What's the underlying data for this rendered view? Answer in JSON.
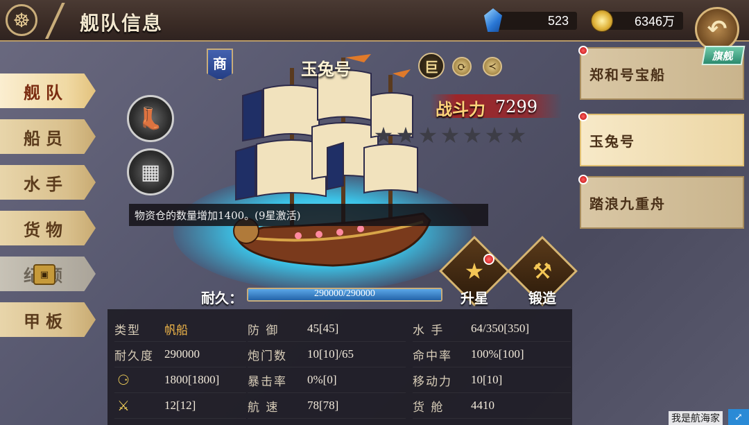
{
  "header": {
    "title": "舰队信息"
  },
  "resources": {
    "gems": "523",
    "gold": "6346万"
  },
  "tabs": [
    {
      "label": "舰队"
    },
    {
      "label": "船员"
    },
    {
      "label": "水手"
    },
    {
      "label": "货物"
    },
    {
      "label": "纪顾"
    },
    {
      "label": "甲板"
    }
  ],
  "ship": {
    "type_badge": "商",
    "name": "玉兔号",
    "size_badge": "巨",
    "power_label": "战斗力",
    "power_value": "7299",
    "stars_total": 7,
    "stars_filled": 0,
    "tooltip": "物资仓的数量增加1400。(9星激活)",
    "durability_label": "耐久：",
    "durability_text": "290000/290000",
    "durability_fraction": 1.0
  },
  "actions": {
    "upgrade_star": "升星",
    "forge": "锻造"
  },
  "stats": {
    "col1": [
      {
        "label": "类型",
        "value": "帆船"
      },
      {
        "label": "耐久度",
        "value": "290000"
      },
      {
        "icon": "cannon-icon",
        "value": "1800[1800]"
      },
      {
        "icon": "crossed-swords-icon",
        "value": "12[12]"
      }
    ],
    "col2": [
      {
        "label": "防 御",
        "value": "45[45]"
      },
      {
        "label": "炮门数",
        "value": "10[10]/65"
      },
      {
        "label": "暴击率",
        "value": "0%[0]"
      },
      {
        "label": "航 速",
        "value": "78[78]"
      }
    ],
    "col3": [
      {
        "label": "水 手",
        "value": "64/350[350]"
      },
      {
        "label": "命中率",
        "value": "100%[100]"
      },
      {
        "label": "移动力",
        "value": "10[10]"
      },
      {
        "label": "货 舱",
        "value": "4410"
      }
    ]
  },
  "fleet_list": [
    {
      "name": "郑和号宝船",
      "flagship": true,
      "active": false
    },
    {
      "name": "玉兔号",
      "flagship": false,
      "active": true
    },
    {
      "name": "踏浪九重舟",
      "flagship": false,
      "active": false
    }
  ],
  "flagship_tag": "旗舰",
  "watermark": "我是航海家",
  "icons": {
    "menu": "ship-wheel-icon",
    "back": "back-arrow-icon",
    "gem": "gem-icon",
    "gold": "gold-coin-icon",
    "boot": "boot-icon",
    "cargo": "cargo-crates-icon"
  }
}
